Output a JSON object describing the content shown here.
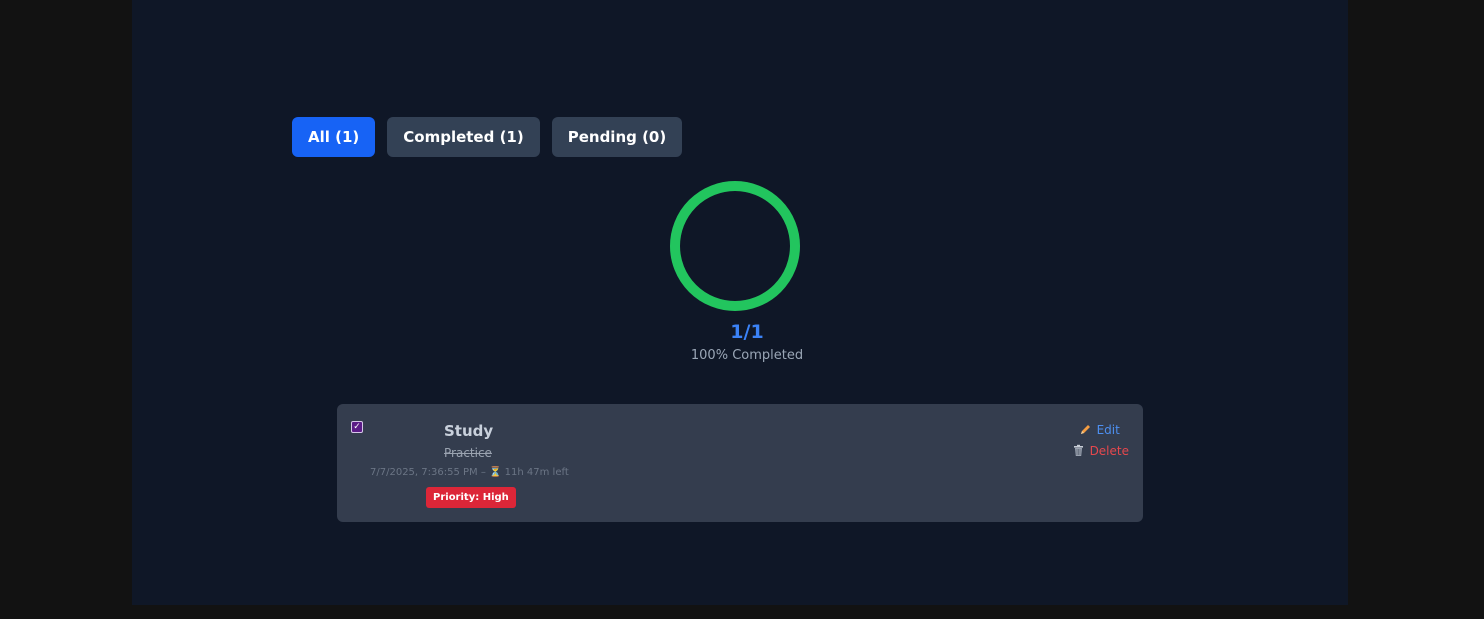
{
  "filters": [
    {
      "label": "All (1)",
      "active": true
    },
    {
      "label": "Completed (1)",
      "active": false
    },
    {
      "label": "Pending (0)",
      "active": false
    }
  ],
  "progress": {
    "count": "1/1",
    "label": "100% Completed",
    "fraction": 1.0,
    "color": "#22c55e"
  },
  "task": {
    "checked": true,
    "title": "Study",
    "description": "Practice",
    "datetime": "7/7/2025, 7:36:55 PM",
    "separator": "–",
    "hourglass_icon": "hourglass-icon",
    "time_left": "11h 47m left",
    "priority": "Priority: High",
    "edit_label": "Edit",
    "delete_label": "Delete",
    "edit_icon": "pencil-icon",
    "delete_icon": "trash-icon"
  },
  "colors": {
    "accent": "#1763f5",
    "card": "#343d4e",
    "priority_high": "#dc2638"
  }
}
